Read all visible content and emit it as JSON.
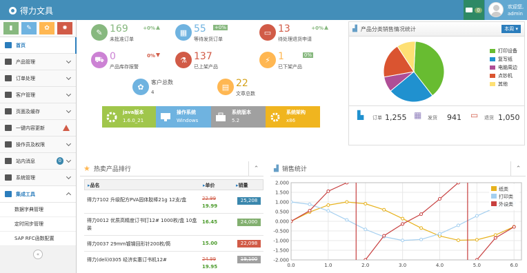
{
  "brand": {
    "title": "得力文具"
  },
  "header": {
    "message_count": "0",
    "welcome": "欢迎您,",
    "username": "admin"
  },
  "shortcuts": [
    {
      "icon": "bar-chart-icon",
      "color": "#87b87f"
    },
    {
      "icon": "pencil-icon",
      "color": "#6fb3e0"
    },
    {
      "icon": "group-icon",
      "color": "#ffb752"
    },
    {
      "icon": "cogs-icon",
      "color": "#d15b47"
    }
  ],
  "nav": {
    "home": "首页",
    "product": "产品管理",
    "order": "订单处理",
    "customer": "客户管理",
    "page_cache": "页面及缓存",
    "update": "一键内容更新",
    "users": "操作员及权限",
    "messages": "站内消息",
    "messages_count": "0",
    "system": "系统管理",
    "integration": "集成工具",
    "sub1": "数据字典管理",
    "sub2": "定时同步管理",
    "sub3": "SAP RFC函数配置"
  },
  "stats": {
    "pending_orders": {
      "num": "169",
      "label": "未批准订单",
      "change": "+0%",
      "color": "#87b87f"
    },
    "shipping": {
      "num": "55",
      "label": "等待发货订单",
      "tag": "+0%",
      "color": "#6fb3e0"
    },
    "returns": {
      "num": "13",
      "label": "待处理退货申请",
      "change": "+0%",
      "color": "#d15b47"
    },
    "stock_alert": {
      "num": "0",
      "label": "产品库存报警",
      "change": "0%",
      "color": "#cc82d4"
    },
    "listed": {
      "num": "137",
      "label": "已上架产品",
      "color": "#d15b47"
    },
    "delisted": {
      "num": "1",
      "label": "已下架产品",
      "tag": "0%",
      "color": "#ffb752"
    },
    "customers": {
      "label": "客户总数",
      "num": "4",
      "color": "#6fb3e0"
    },
    "articles": {
      "num": "22",
      "label": "文章总数",
      "color": "#ffb752"
    }
  },
  "sysinfo": [
    {
      "name": "java版本",
      "value": "1.6.0_21",
      "color": "#a0c64b"
    },
    {
      "name": "操作系统",
      "value": "Windows",
      "color": "#6fb3e0"
    },
    {
      "name": "系统版本",
      "value": "5.2",
      "color": "#a0a0a0"
    },
    {
      "name": "系统架构",
      "value": "x86",
      "color": "#f0b51f"
    }
  ],
  "pie": {
    "title": "产品分类销售情况统计",
    "period": "本周",
    "slices": [
      {
        "name": "打印设备",
        "value": 38.7,
        "color": "#68bc31"
      },
      {
        "name": "复写纸",
        "value": 24.5,
        "color": "#2091cf"
      },
      {
        "name": "电脑周边",
        "value": 8.2,
        "color": "#af4e96"
      },
      {
        "name": "点钞机",
        "value": 18.6,
        "color": "#da5430"
      },
      {
        "name": "其他",
        "value": 10,
        "color": "#fee074"
      }
    ],
    "footer": [
      {
        "label": "订单",
        "value": "1,255",
        "icon": "bar-chart-icon",
        "color": "#2091cf"
      },
      {
        "label": "发货",
        "value": "941",
        "icon": "calendar-icon",
        "color": "#9585bf"
      },
      {
        "label": "退货",
        "value": "1,050",
        "icon": "credit-card-icon",
        "color": "#d15b47"
      }
    ]
  },
  "hot": {
    "title": "热卖产品排行",
    "col_name": "品名",
    "col_price": "单价",
    "col_sales": "销量",
    "rows": [
      {
        "name": "得力7102 升级配方PVA固体胶棒21g 12支/盒",
        "old_price": "22.99",
        "price": "19.99",
        "sales": "25,208",
        "color": "#3a87ad"
      },
      {
        "name": "得力0012 优质高精度订书钉12# 1000枚/盒 10盒装",
        "price": "16.45",
        "sales": "24,000",
        "color": "#82af6f"
      },
      {
        "name": "得力0037 29mm镀镍回形针200枚/筒",
        "price": "15.00",
        "sales": "22,098",
        "color": "#d15b47"
      },
      {
        "name": "得力(deli)0305 经济实惠订书机12#",
        "old_price": "24.99",
        "price": "19.95",
        "sales": "19,100",
        "color": "#a0a0a0"
      }
    ]
  },
  "sales_chart": {
    "title": "销售统计"
  },
  "chart_data": {
    "type": "line",
    "title": "",
    "xlabel": "",
    "ylabel": "",
    "x": [
      0,
      0.5,
      1,
      1.5,
      2,
      2.5,
      3,
      3.5,
      4,
      4.5,
      5,
      5.5,
      6
    ],
    "xlim": [
      0,
      6.2
    ],
    "ylim": [
      -2,
      2
    ],
    "xticks": [
      "0.0",
      "1.0",
      "2.0",
      "3.0",
      "4.0",
      "5.0",
      "6.0"
    ],
    "yticks": [
      "2.000",
      "1.500",
      "1.000",
      "0.500",
      "0.000",
      "-0.500",
      "-1.000",
      "-1.500",
      "-2.000"
    ],
    "series": [
      {
        "name": "纸类",
        "color": "#e7b21d",
        "values": [
          0,
          0.48,
          0.84,
          1.0,
          0.91,
          0.6,
          0.14,
          -0.35,
          -0.76,
          -0.98,
          -0.96,
          -0.71,
          -0.28
        ]
      },
      {
        "name": "打印类",
        "color": "#a4cff0",
        "values": [
          1,
          0.88,
          0.54,
          0.07,
          -0.42,
          -0.8,
          -0.99,
          -0.94,
          -0.65,
          -0.21,
          0.28,
          0.71,
          0.96
        ]
      },
      {
        "name": "外设类",
        "color": "#c73f3f",
        "values": [
          0,
          0.55,
          1.56,
          2,
          -2,
          -0.75,
          -0.14,
          0.37,
          1.16,
          2,
          -2,
          -0.86,
          -0.29
        ]
      }
    ],
    "legend": "top-right",
    "grid": true
  }
}
